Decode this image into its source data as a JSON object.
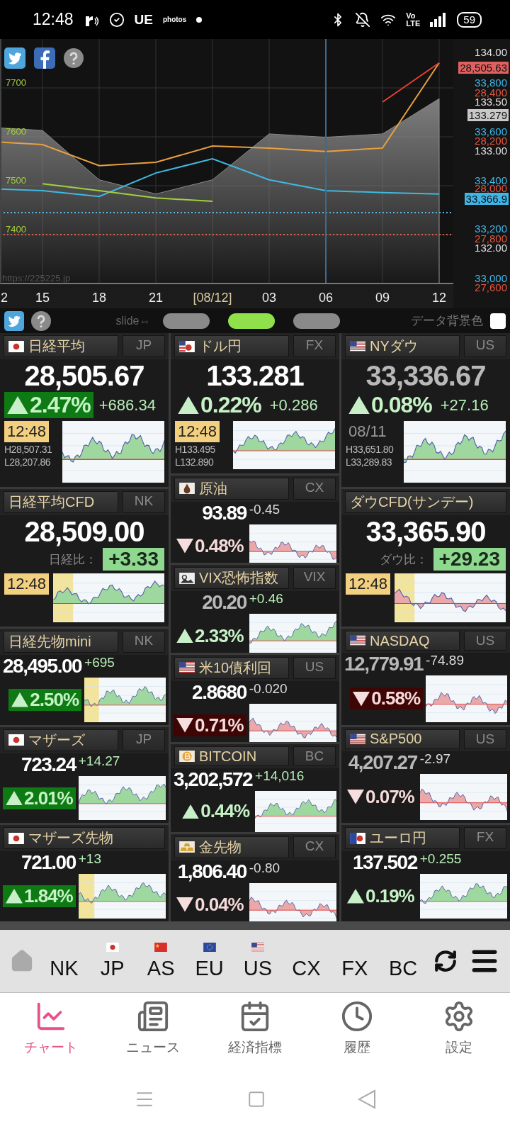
{
  "status_bar": {
    "time": "12:48",
    "app_labels": [
      "UE",
      "photos"
    ],
    "volte": [
      "Vo",
      "LTE"
    ],
    "battery": "59"
  },
  "chart": {
    "watermark": "https://225225.jp",
    "right_axis": [
      {
        "label": "134.00",
        "color": "#e0e0e0",
        "kind": "tick"
      },
      {
        "label": "28,505.63",
        "color": "#e06060",
        "kind": "tag"
      },
      {
        "label": "33,800",
        "color": "#3fb6e8",
        "kind": "tick"
      },
      {
        "label": "28,400",
        "color": "#e5553f",
        "kind": "tick"
      },
      {
        "label": "133.50",
        "color": "#e0e0e0",
        "kind": "tick"
      },
      {
        "label": "133.279",
        "color": "#c8c8c8",
        "kind": "tag"
      },
      {
        "label": "33,600",
        "color": "#3fb6e8",
        "kind": "tick"
      },
      {
        "label": "28,200",
        "color": "#e5553f",
        "kind": "tick"
      },
      {
        "label": "133.00",
        "color": "#e0e0e0",
        "kind": "tick"
      },
      {
        "label": "33,400",
        "color": "#3fb6e8",
        "kind": "tick"
      },
      {
        "label": "28,000",
        "color": "#e5553f",
        "kind": "tick"
      },
      {
        "label": "33,366.9",
        "color": "#3fb6e8",
        "kind": "tag"
      },
      {
        "label": "33,200",
        "color": "#3fb6e8",
        "kind": "tick"
      },
      {
        "label": "27,800",
        "color": "#e5553f",
        "kind": "tick"
      },
      {
        "label": "132.00",
        "color": "#e0e0e0",
        "kind": "tick"
      },
      {
        "label": "33,000",
        "color": "#3fb6e8",
        "kind": "tick"
      },
      {
        "label": "27,600",
        "color": "#e5553f",
        "kind": "tick"
      }
    ],
    "chart_data": {
      "type": "line",
      "categories": [
        "2",
        "15",
        "18",
        "21",
        "[08/12]",
        "03",
        "06",
        "09",
        "12"
      ],
      "ylim": [
        7300,
        7800
      ],
      "yticks": [
        7400,
        7500,
        7600,
        7700
      ],
      "grid": true,
      "ref_lines": [
        {
          "axis": "y",
          "value": 7445,
          "color": "#5bb8e8"
        },
        {
          "axis": "y",
          "value": 7400,
          "color": "#e06050"
        },
        {
          "axis": "x",
          "value": "06",
          "color": "#3f6a8f"
        }
      ],
      "series": [
        {
          "type": "area",
          "color": "#8a8a8a",
          "values": [
            7620,
            7613,
            7512,
            7483,
            7512,
            7606,
            7599,
            7606,
            7678
          ]
        },
        {
          "color": "#e8a040",
          "values": [
            7591,
            7584,
            7541,
            7548,
            7581,
            7577,
            7570,
            7577,
            7751
          ]
        },
        {
          "color": "#40b8e0",
          "values": [
            7494,
            7490,
            7478,
            7526,
            7555,
            7512,
            7490,
            7486,
            7483
          ]
        },
        {
          "color": "#a0d040",
          "values": [
            null,
            7504,
            7490,
            7475,
            7468,
            null,
            null,
            null,
            null
          ]
        },
        {
          "color": "#e84030",
          "values": [
            null,
            null,
            null,
            null,
            null,
            null,
            null,
            7671,
            7751
          ]
        }
      ]
    }
  },
  "toolbar": {
    "slide_label": "slide⇔",
    "pages": [
      {
        "selected": false
      },
      {
        "selected": true
      },
      {
        "selected": false
      }
    ],
    "data_bg": {
      "label": "データ背景色",
      "checked": false
    }
  },
  "columns": [
    {
      "tiles": [
        {
          "kind": "large",
          "flag": {
            "kind": "jp"
          },
          "name": "日経平均",
          "code": "JP",
          "price": "28,505.67",
          "stale": false,
          "rising": true,
          "pct": "2.47%",
          "pct_box": true,
          "change": "+686.34",
          "time": "12:48",
          "time_highlight": true,
          "high": "H28,507.31",
          "low": "L28,207.86",
          "band": false
        },
        {
          "kind": "cfd",
          "name": "日経平均CFD",
          "code": "NK",
          "price": "28,509.00",
          "stale": false,
          "diff_label": "日経比：",
          "diff": "+3.33",
          "time": "12:48",
          "time_highlight": true,
          "rising": true,
          "band": true
        },
        {
          "kind": "small",
          "name": "日経先物mini",
          "code": "NK",
          "price": "28,495.00",
          "stale": false,
          "change": "+695",
          "rising": true,
          "pct": "2.50%",
          "pct_box": true,
          "band": true
        },
        {
          "kind": "small",
          "flag": {
            "kind": "jp"
          },
          "name": "マザーズ",
          "code": "JP",
          "price": "723.24",
          "stale": false,
          "change": "+14.27",
          "rising": true,
          "pct": "2.01%",
          "pct_box": true,
          "band": false
        },
        {
          "kind": "small",
          "flag": {
            "kind": "jp"
          },
          "name": "マザーズ先物",
          "price": "721.00",
          "stale": false,
          "change": "+13",
          "rising": true,
          "pct": "1.84%",
          "pct_box": true,
          "band": true
        }
      ]
    },
    {
      "tiles": [
        {
          "kind": "large",
          "flag": {
            "kind": "usjp"
          },
          "name": "ドル円",
          "code": "FX",
          "price": "133.281",
          "stale": false,
          "rising": true,
          "pct": "0.22%",
          "pct_box": false,
          "change": "+0.286",
          "time": "12:48",
          "time_highlight": true,
          "high": "H133.495",
          "low": "L132.890",
          "band": false
        },
        {
          "kind": "small",
          "flag": {
            "kind": "oil"
          },
          "name": "原油",
          "code": "CX",
          "price": "93.89",
          "stale": false,
          "change": "-0.45",
          "rising": false,
          "pct": "0.48%",
          "pct_box": false,
          "band": false
        },
        {
          "kind": "small",
          "flag": {
            "kind": "vix"
          },
          "name": "VIX恐怖指数",
          "code": "VIX",
          "price": "20.20",
          "stale": true,
          "change": "+0.46",
          "rising": true,
          "pct": "2.33%",
          "pct_box": false,
          "band": false
        },
        {
          "kind": "small",
          "flag": {
            "kind": "us"
          },
          "name": "米10債利回",
          "code": "US",
          "price": "2.8680",
          "stale": false,
          "change": "-0.020",
          "rising": false,
          "pct": "0.71%",
          "pct_box": true,
          "band": false
        },
        {
          "kind": "small",
          "flag": {
            "kind": "btc"
          },
          "name": "BITCOIN",
          "code": "BC",
          "price": "3,202,572",
          "stale": false,
          "change": "+14,016",
          "rising": true,
          "pct": "0.44%",
          "pct_box": false,
          "band": false
        },
        {
          "kind": "small",
          "flag": {
            "kind": "gold"
          },
          "name": "金先物",
          "code": "CX",
          "price": "1,806.40",
          "stale": false,
          "change": "-0.80",
          "rising": false,
          "pct": "0.04%",
          "pct_box": false,
          "band": false
        }
      ]
    },
    {
      "tiles": [
        {
          "kind": "large",
          "flag": {
            "kind": "us"
          },
          "name": "NYダウ",
          "code": "US",
          "price": "33,336.67",
          "stale": true,
          "rising": true,
          "pct": "0.08%",
          "pct_box": false,
          "change": "+27.16",
          "time": "08/11",
          "time_highlight": false,
          "high": "H33,651.80",
          "low": "L33,289.83",
          "band": false
        },
        {
          "kind": "cfd",
          "name": "ダウCFD(サンデー)",
          "price": "33,365.90",
          "stale": false,
          "diff_label": "ダウ比：",
          "diff": "+29.23",
          "time": "12:48",
          "time_highlight": true,
          "rising": false,
          "band": true
        },
        {
          "kind": "small",
          "flag": {
            "kind": "us"
          },
          "name": "NASDAQ",
          "code": "US",
          "price": "12,779.91",
          "stale": true,
          "change": "-74.89",
          "rising": false,
          "pct": "0.58%",
          "pct_box": true,
          "band": false
        },
        {
          "kind": "small",
          "flag": {
            "kind": "us"
          },
          "name": "S&P500",
          "code": "US",
          "price": "4,207.27",
          "stale": true,
          "change": "-2.97",
          "rising": false,
          "pct": "0.07%",
          "pct_box": false,
          "band": false
        },
        {
          "kind": "small",
          "flag": {
            "kind": "eujp"
          },
          "name": "ユーロ円",
          "code": "FX",
          "price": "137.502",
          "stale": false,
          "change": "+0.255",
          "rising": true,
          "pct": "0.19%",
          "pct_box": false,
          "band": false
        }
      ]
    }
  ],
  "market_bar": {
    "items": [
      {
        "label": "NK"
      },
      {
        "label": "JP",
        "flag": {
          "kind": "jp"
        }
      },
      {
        "label": "AS",
        "flag": {
          "kind": "cn"
        }
      },
      {
        "label": "EU",
        "flag": {
          "kind": "eu"
        }
      },
      {
        "label": "US",
        "flag": {
          "kind": "us"
        }
      },
      {
        "label": "CX"
      },
      {
        "label": "FX"
      },
      {
        "label": "BC"
      }
    ]
  },
  "tab_bar": {
    "tabs": [
      {
        "label": "チャート",
        "selected": true
      },
      {
        "label": "ニュース",
        "selected": false
      },
      {
        "label": "経済指標",
        "selected": false
      },
      {
        "label": "履歴",
        "selected": false
      },
      {
        "label": "設定",
        "selected": false
      }
    ]
  }
}
